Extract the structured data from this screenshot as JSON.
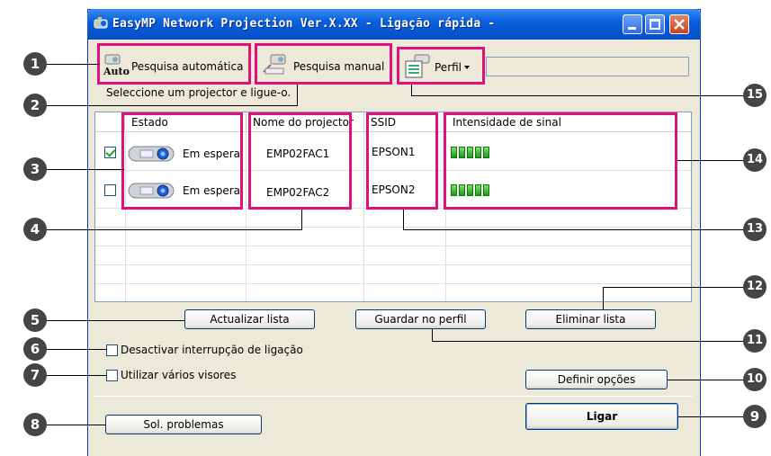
{
  "window": {
    "title": "EasyMP Network Projection Ver.X.XX - Ligação rápida -"
  },
  "toolbar": {
    "auto_search_label": "Pesquisa automática",
    "auto_icon_text": "Auto",
    "manual_search_label": "Pesquisa manual",
    "profile_label": "Perfil"
  },
  "hint": "Seleccione um projector e ligue-o.",
  "table": {
    "headers": [
      "Estado",
      "Nome do projector",
      "SSID",
      "Intensidade de sinal"
    ],
    "rows": [
      {
        "checked": true,
        "status": "Em espera",
        "name": "EMP02FAC1",
        "ssid": "EPSON1",
        "signal_bars": 5
      },
      {
        "checked": false,
        "status": "Em espera",
        "name": "EMP02FAC2",
        "ssid": "EPSON2",
        "signal_bars": 5
      }
    ]
  },
  "buttons": {
    "update_list": "Actualizar lista",
    "save_profile": "Guardar no perfil",
    "delete_list": "Eliminar lista",
    "set_options": "Definir opções",
    "troubleshoot": "Sol. problemas",
    "connect": "Ligar"
  },
  "options": {
    "disable_interrupt": "Desactivar interrupção de ligação",
    "multi_display": "Utilizar vários visores"
  },
  "callouts": [
    "1",
    "2",
    "3",
    "4",
    "5",
    "6",
    "7",
    "8",
    "9",
    "10",
    "11",
    "12",
    "13",
    "14",
    "15"
  ],
  "colors": {
    "highlight": "#e0117a",
    "titlebar": "#0a5fdc",
    "callout": "#454545"
  }
}
